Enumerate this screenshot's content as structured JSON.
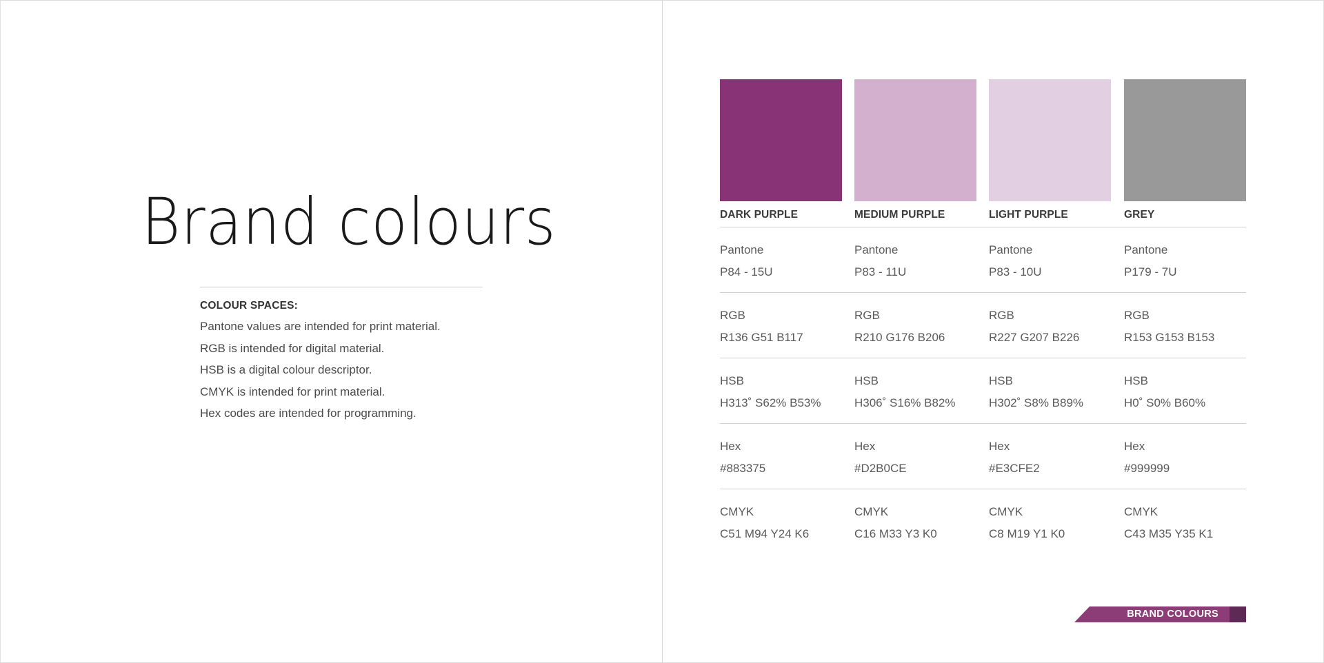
{
  "left_page": {
    "title": "Brand colours",
    "notes_heading": "COLOUR SPACES:",
    "notes": [
      "Pantone values are intended for print material.",
      "RGB is intended for digital material.",
      "HSB is a digital colour descriptor.",
      "CMYK is intended for print material.",
      "Hex codes are intended for programming."
    ]
  },
  "right_page": {
    "colours": [
      {
        "name": "DARK PURPLE",
        "swatch": "#883375",
        "pantone_label": "Pantone",
        "pantone": "P84 - 15U",
        "rgb_label": "RGB",
        "rgb": "R136 G51 B117",
        "hsb_label": "HSB",
        "hsb": "H313˚ S62% B53%",
        "hex_label": "Hex",
        "hex": "#883375",
        "cmyk_label": "CMYK",
        "cmyk": "C51 M94 Y24 K6"
      },
      {
        "name": "MEDIUM PURPLE",
        "swatch": "#D2B0CE",
        "pantone_label": "Pantone",
        "pantone": "P83 - 11U",
        "rgb_label": "RGB",
        "rgb": "R210 G176 B206",
        "hsb_label": "HSB",
        "hsb": "H306˚ S16% B82%",
        "hex_label": "Hex",
        "hex": "#D2B0CE",
        "cmyk_label": "CMYK",
        "cmyk": "C16 M33 Y3 K0"
      },
      {
        "name": "LIGHT PURPLE",
        "swatch": "#E3CFE2",
        "pantone_label": "Pantone",
        "pantone": "P83 - 10U",
        "rgb_label": "RGB",
        "rgb": "R227 G207 B226",
        "hsb_label": "HSB",
        "hsb": "H302˚ S8% B89%",
        "hex_label": "Hex",
        "hex": "#E3CFE2",
        "cmyk_label": "CMYK",
        "cmyk": "C8 M19 Y1 K0"
      },
      {
        "name": "GREY",
        "swatch": "#999999",
        "pantone_label": "Pantone",
        "pantone": "P179 - 7U",
        "rgb_label": "RGB",
        "rgb": "R153 G153 B153",
        "hsb_label": "HSB",
        "hsb": "H0˚ S0% B60%",
        "hex_label": "Hex",
        "hex": "#999999",
        "cmyk_label": "CMYK",
        "cmyk": "C43 M35 Y35 K1"
      }
    ],
    "section_tag": "BRAND COLOURS"
  },
  "colors": {
    "tag_fill": "#8C3D78",
    "tag_end": "#5E2A55"
  }
}
